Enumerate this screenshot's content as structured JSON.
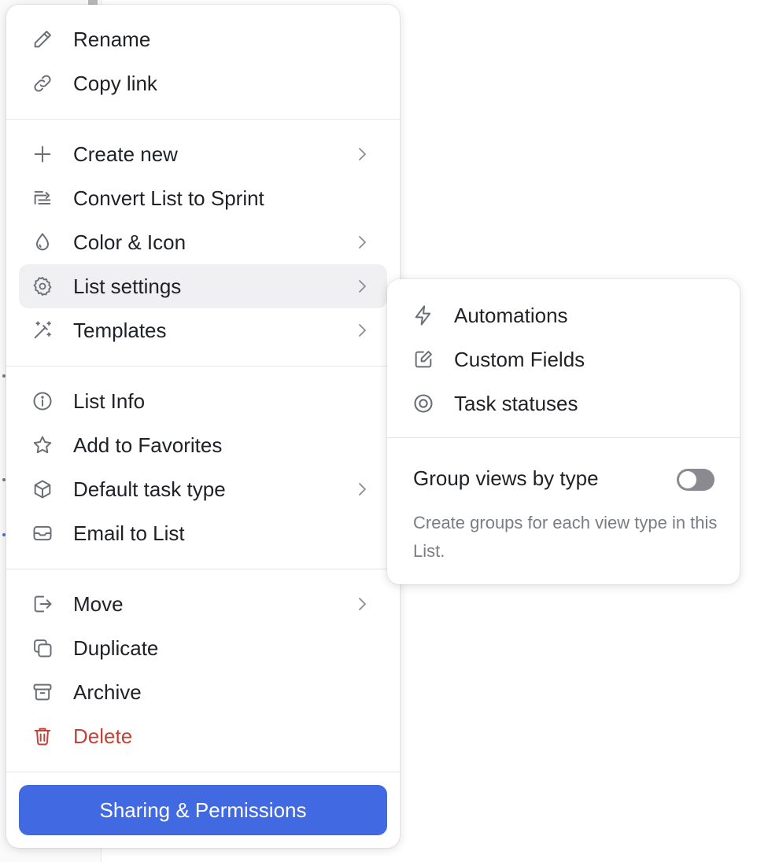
{
  "menu": {
    "groups": [
      {
        "items": [
          {
            "label": "Rename",
            "icon": "pencil-icon"
          },
          {
            "label": "Copy link",
            "icon": "link-icon"
          }
        ]
      },
      {
        "items": [
          {
            "label": "Create new",
            "icon": "plus-icon",
            "submenu": true
          },
          {
            "label": "Convert List to Sprint",
            "icon": "sprint-icon"
          },
          {
            "label": "Color & Icon",
            "icon": "droplet-icon",
            "submenu": true
          },
          {
            "label": "List settings",
            "icon": "gear-icon",
            "submenu": true,
            "active": true
          },
          {
            "label": "Templates",
            "icon": "magic-wand-icon",
            "submenu": true
          }
        ]
      },
      {
        "items": [
          {
            "label": "List Info",
            "icon": "info-icon"
          },
          {
            "label": "Add to Favorites",
            "icon": "star-icon"
          },
          {
            "label": "Default task type",
            "icon": "cube-icon",
            "submenu": true
          },
          {
            "label": "Email to List",
            "icon": "mail-icon"
          }
        ]
      },
      {
        "items": [
          {
            "label": "Move",
            "icon": "move-out-icon",
            "submenu": true
          },
          {
            "label": "Duplicate",
            "icon": "duplicate-icon"
          },
          {
            "label": "Archive",
            "icon": "archive-icon"
          },
          {
            "label": "Delete",
            "icon": "trash-icon",
            "danger": true
          }
        ]
      }
    ],
    "share_button_label": "Sharing & Permissions"
  },
  "submenu": {
    "items": [
      {
        "label": "Automations",
        "icon": "lightning-icon"
      },
      {
        "label": "Custom Fields",
        "icon": "edit-box-icon"
      },
      {
        "label": "Task statuses",
        "icon": "target-icon"
      }
    ],
    "toggle_label": "Group views by type",
    "toggle_on": false,
    "toggle_description": "Create groups for each view type in this List."
  },
  "colors": {
    "accent": "#4169e1",
    "danger": "#c0433a",
    "active_bg": "#f0f0f2"
  }
}
